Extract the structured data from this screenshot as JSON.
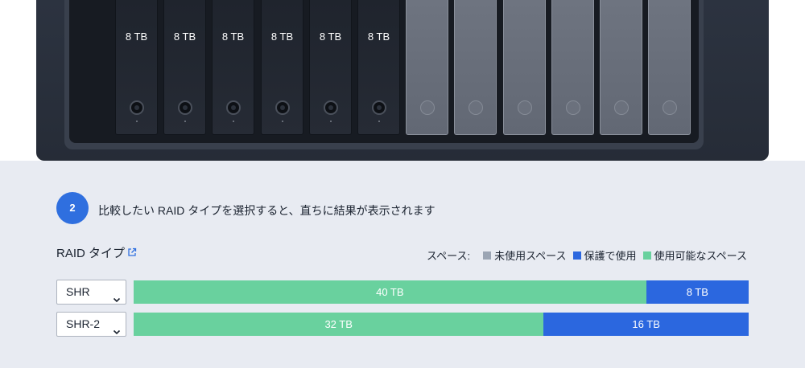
{
  "device": {
    "bays": [
      {
        "label": "8 TB",
        "state": "filled"
      },
      {
        "label": "8 TB",
        "state": "filled"
      },
      {
        "label": "8 TB",
        "state": "filled"
      },
      {
        "label": "8 TB",
        "state": "filled"
      },
      {
        "label": "8 TB",
        "state": "filled"
      },
      {
        "label": "8 TB",
        "state": "filled"
      },
      {
        "label": "",
        "state": "empty"
      },
      {
        "label": "",
        "state": "empty"
      },
      {
        "label": "",
        "state": "empty"
      },
      {
        "label": "",
        "state": "empty"
      },
      {
        "label": "",
        "state": "empty"
      },
      {
        "label": "",
        "state": "empty"
      }
    ]
  },
  "step": {
    "number": "2",
    "instruction": "比較したい RAID タイプを選択すると、直ちに結果が表示されます"
  },
  "raid_type": {
    "label": "RAID タイプ",
    "icon": "external-link-icon"
  },
  "legend": {
    "title": "スペース:",
    "items": [
      {
        "label": "未使用スペース",
        "color": "#9ba5b4"
      },
      {
        "label": "保護で使用",
        "color": "#2b67df"
      },
      {
        "label": "使用可能なスペース",
        "color": "#69d19e"
      }
    ]
  },
  "rows": [
    {
      "selected": "SHR",
      "segments": [
        {
          "label": "40 TB",
          "value": 40,
          "kind": "usable"
        },
        {
          "label": "8 TB",
          "value": 8,
          "kind": "protect"
        }
      ]
    },
    {
      "selected": "SHR-2",
      "segments": [
        {
          "label": "32 TB",
          "value": 32,
          "kind": "usable"
        },
        {
          "label": "16 TB",
          "value": 16,
          "kind": "protect"
        }
      ]
    }
  ],
  "colors": {
    "accent": "#2f6fdf",
    "usable": "#69d19e",
    "protect": "#2b67df",
    "unused": "#9ba5b4"
  }
}
